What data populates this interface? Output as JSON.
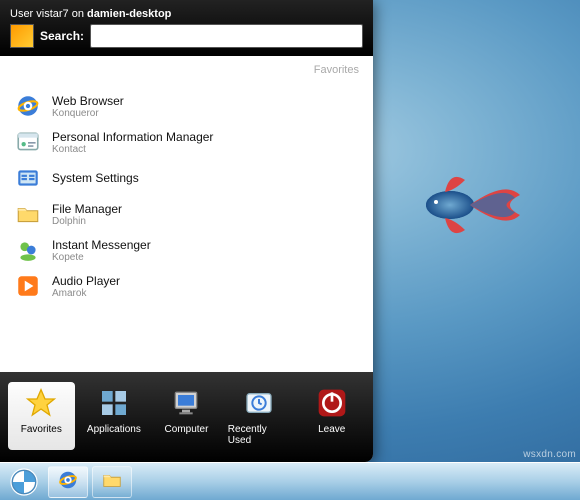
{
  "header": {
    "user_prefix": "User ",
    "username": "vistar7",
    "on": " on ",
    "hostname": "damien-desktop",
    "search_label": "Search:",
    "search_value": ""
  },
  "section_label": "Favorites",
  "items": [
    {
      "title": "Web Browser",
      "sub": "Konqueror",
      "icon": "ie"
    },
    {
      "title": "Personal Information Manager",
      "sub": "Kontact",
      "icon": "pim"
    },
    {
      "title": "System Settings",
      "sub": "",
      "icon": "settings"
    },
    {
      "title": "File Manager",
      "sub": "Dolphin",
      "icon": "folder"
    },
    {
      "title": "Instant Messenger",
      "sub": "Kopete",
      "icon": "im"
    },
    {
      "title": "Audio Player",
      "sub": "Amarok",
      "icon": "audio"
    }
  ],
  "tabs": [
    {
      "label": "Favorites",
      "icon": "star",
      "active": true
    },
    {
      "label": "Applications",
      "icon": "apps"
    },
    {
      "label": "Computer",
      "icon": "computer"
    },
    {
      "label": "Recently Used",
      "icon": "recent"
    },
    {
      "label": "Leave",
      "icon": "power",
      "leave": true
    }
  ],
  "taskbar": {
    "items": [
      "ie",
      "folder"
    ]
  },
  "watermark": "wsxdn.com"
}
